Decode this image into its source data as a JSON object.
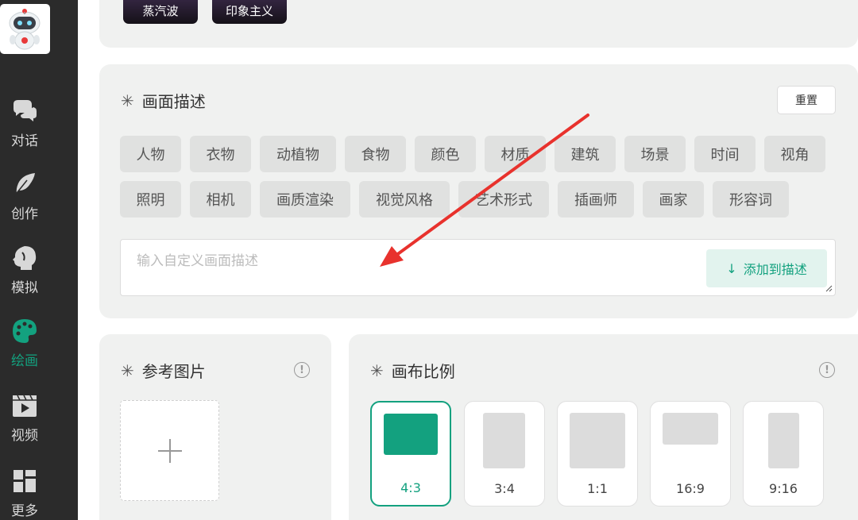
{
  "sidebar": {
    "items": [
      {
        "label": "对话",
        "icon": "chat-bubbles-icon",
        "active": false
      },
      {
        "label": "创作",
        "icon": "feather-icon",
        "active": false
      },
      {
        "label": "模拟",
        "icon": "head-profile-icon",
        "active": false
      },
      {
        "label": "绘画",
        "icon": "palette-icon",
        "active": true
      },
      {
        "label": "视频",
        "icon": "video-play-icon",
        "active": false
      },
      {
        "label": "更多",
        "icon": "grid-blocks-icon",
        "active": false
      }
    ],
    "logo_icon": "robot-logo-icon"
  },
  "styles": {
    "items": [
      {
        "label": "蒸汽波"
      },
      {
        "label": "印象主义"
      }
    ]
  },
  "description": {
    "title": "画面描述",
    "reset_label": "重置",
    "tags": [
      "人物",
      "衣物",
      "动植物",
      "食物",
      "颜色",
      "材质",
      "建筑",
      "场景",
      "时间",
      "视角",
      "照明",
      "相机",
      "画质渲染",
      "视觉风格",
      "艺术形式",
      "插画师",
      "画家",
      "形容词"
    ],
    "input_placeholder": "输入自定义画面描述",
    "add_label": "添加到描述",
    "add_icon": "arrow-down-icon"
  },
  "reference": {
    "title": "参考图片",
    "upload_icon": "plus-icon"
  },
  "canvas": {
    "title": "画布比例",
    "ratios": [
      {
        "label": "4:3",
        "selected": true
      },
      {
        "label": "3:4",
        "selected": false
      },
      {
        "label": "1:1",
        "selected": false
      },
      {
        "label": "16:9",
        "selected": false
      },
      {
        "label": "9:16",
        "selected": false
      }
    ]
  },
  "colors": {
    "accent": "#13a17f",
    "sidebar_bg": "#2b2b2b",
    "panel_bg": "#f0f1f0",
    "annotation_arrow": "#e8322d"
  }
}
